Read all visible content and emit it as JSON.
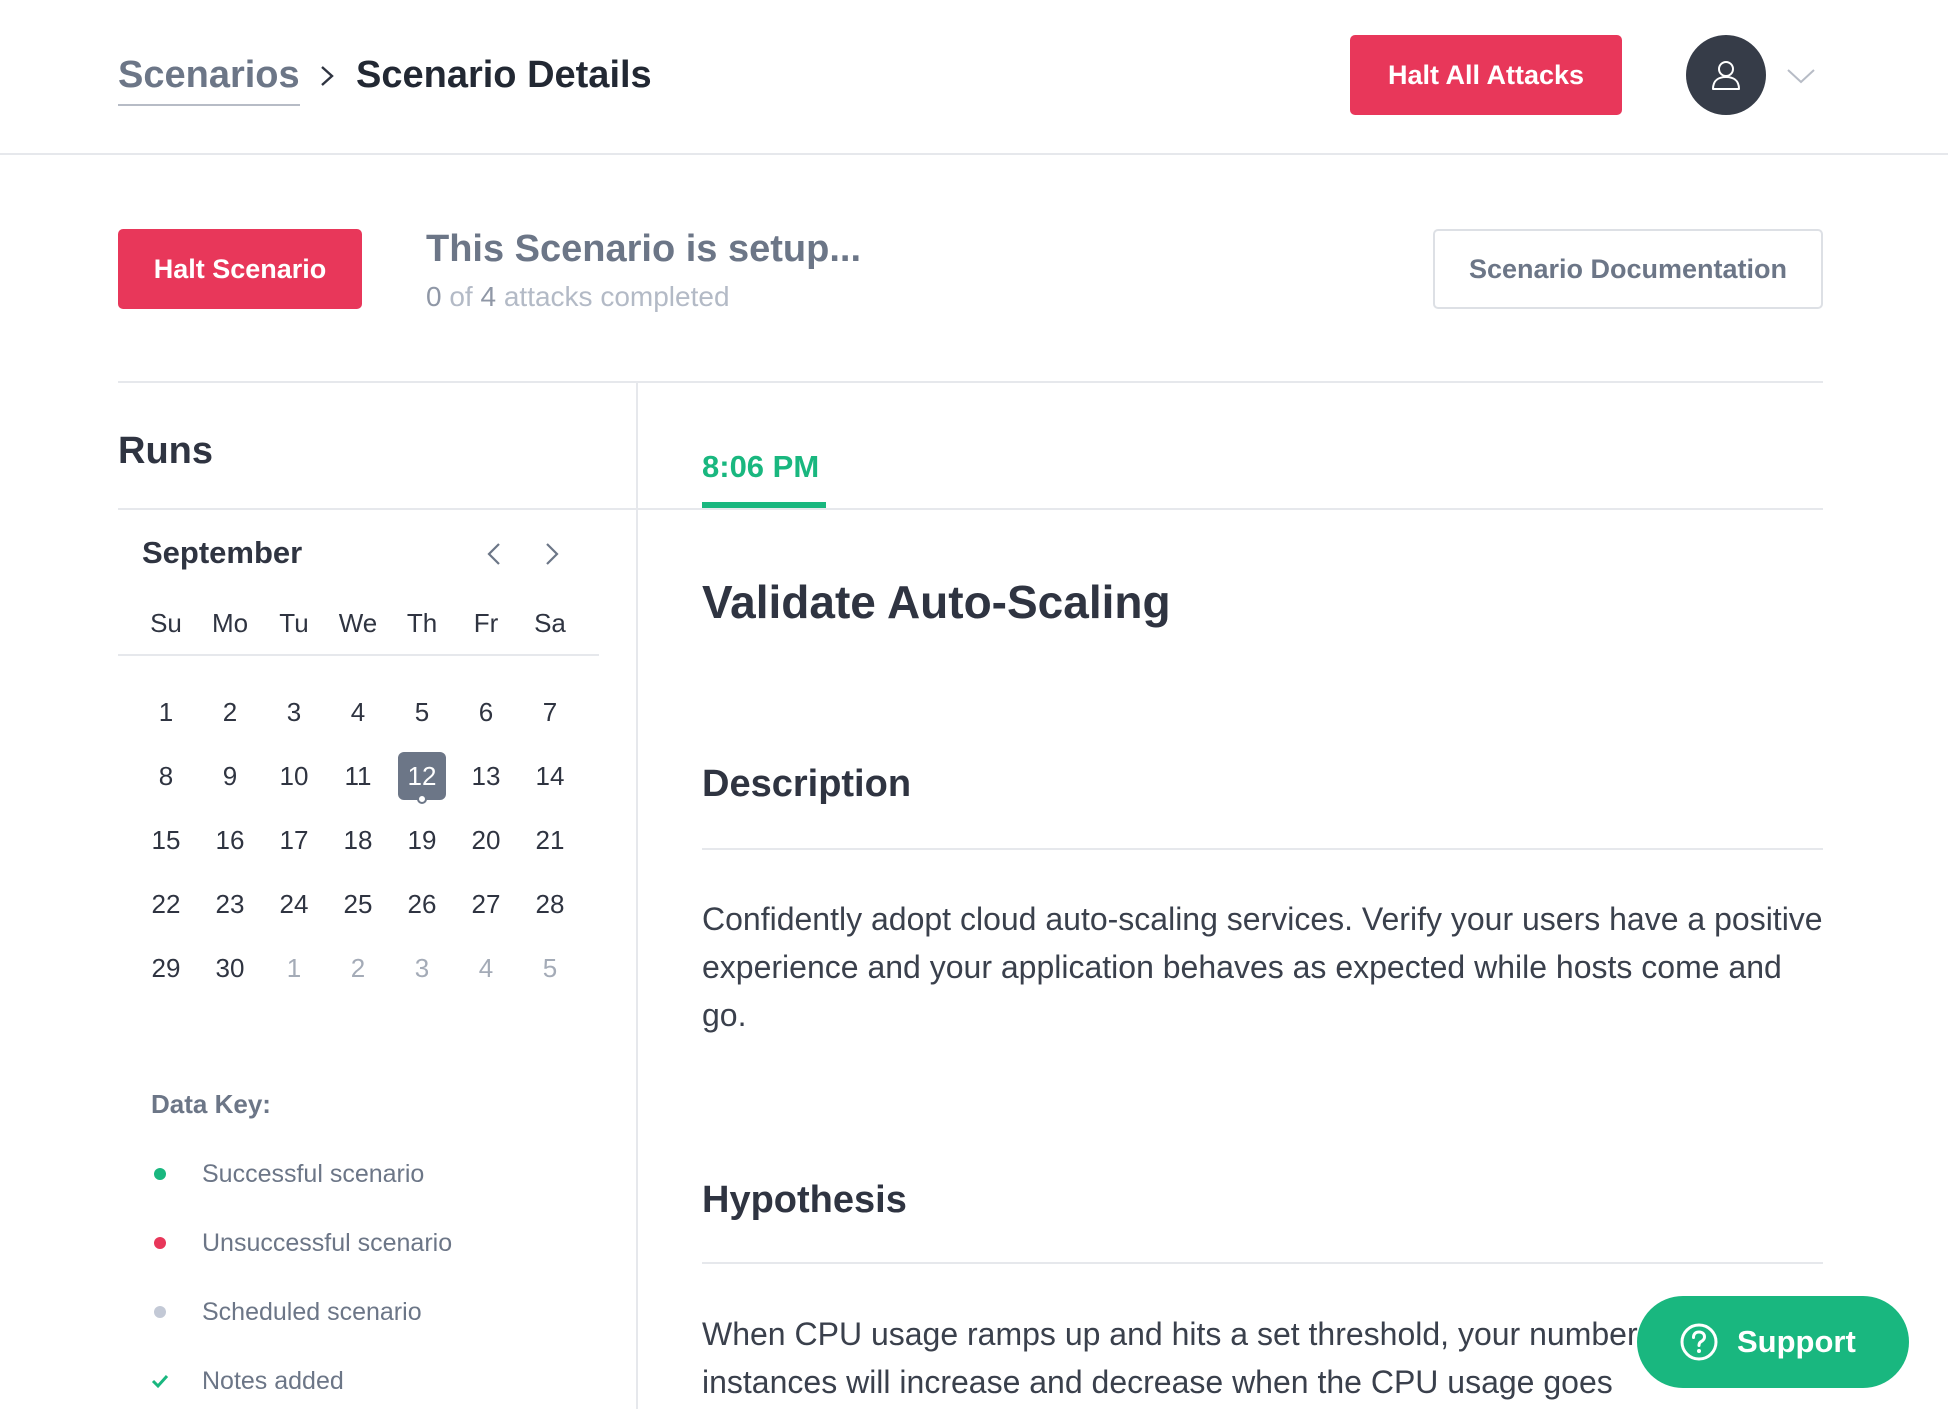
{
  "header": {
    "breadcrumb_root": "Scenarios",
    "breadcrumb_current": "Scenario Details",
    "halt_all_label": "Halt All Attacks"
  },
  "status": {
    "halt_label": "Halt Scenario",
    "title": "This Scenario is setup...",
    "completed": "0",
    "of_text": " of ",
    "total": "4",
    "suffix": " attacks completed",
    "doc_label": "Scenario Documentation"
  },
  "runs": {
    "title": "Runs",
    "month": "September",
    "weekdays": [
      "Su",
      "Mo",
      "Tu",
      "We",
      "Th",
      "Fr",
      "Sa"
    ],
    "days": [
      {
        "d": "1"
      },
      {
        "d": "2"
      },
      {
        "d": "3"
      },
      {
        "d": "4"
      },
      {
        "d": "5"
      },
      {
        "d": "6"
      },
      {
        "d": "7"
      },
      {
        "d": "8"
      },
      {
        "d": "9"
      },
      {
        "d": "10"
      },
      {
        "d": "11"
      },
      {
        "d": "12",
        "selected": true,
        "marker": true
      },
      {
        "d": "13"
      },
      {
        "d": "14"
      },
      {
        "d": "15"
      },
      {
        "d": "16"
      },
      {
        "d": "17"
      },
      {
        "d": "18"
      },
      {
        "d": "19"
      },
      {
        "d": "20"
      },
      {
        "d": "21"
      },
      {
        "d": "22"
      },
      {
        "d": "23"
      },
      {
        "d": "24"
      },
      {
        "d": "25"
      },
      {
        "d": "26"
      },
      {
        "d": "27"
      },
      {
        "d": "28"
      },
      {
        "d": "29"
      },
      {
        "d": "30"
      },
      {
        "d": "1",
        "muted": true
      },
      {
        "d": "2",
        "muted": true
      },
      {
        "d": "3",
        "muted": true
      },
      {
        "d": "4",
        "muted": true
      },
      {
        "d": "5",
        "muted": true
      }
    ],
    "data_key": {
      "title": "Data Key:",
      "items": [
        {
          "label": "Successful scenario",
          "icon": "dot",
          "color": "#19b77f"
        },
        {
          "label": "Unsuccessful scenario",
          "icon": "dot",
          "color": "#e8375a"
        },
        {
          "label": "Scheduled scenario",
          "icon": "dot",
          "color": "#c3c9d6"
        },
        {
          "label": "Notes added",
          "icon": "check",
          "color": "#19b77f"
        }
      ]
    }
  },
  "detail": {
    "tab_time": "8:06 PM",
    "scenario_name": "Validate Auto-Scaling",
    "description_title": "Description",
    "description_text": "Confidently adopt cloud auto-scaling services. Verify your users have a positive experience and your application behaves as expected while hosts come and go.",
    "hypothesis_title": "Hypothesis",
    "hypothesis_text": "When CPU usage ramps up and hits a set threshold, your number of active instances will increase and decrease when the CPU usage goes"
  },
  "support": {
    "label": "Support"
  },
  "colors": {
    "accent_red": "#e8375a",
    "accent_green": "#19b77f",
    "slate": "#6c7687"
  }
}
